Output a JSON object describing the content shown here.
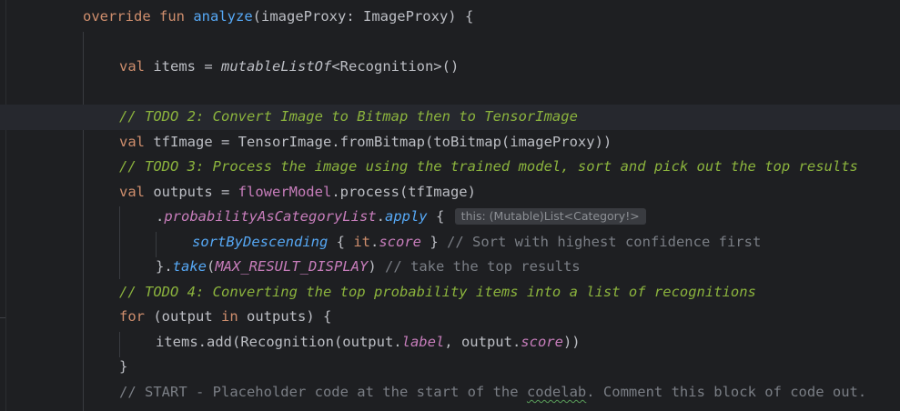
{
  "colors": {
    "background": "#1e1f22",
    "keyword": "#cf8e6d",
    "function": "#56a8f5",
    "comment": "#7a7e85",
    "todo_comment": "#8bb33d",
    "property": "#c77dbb",
    "text": "#bcbec4"
  },
  "code": {
    "l1": {
      "override": "override",
      "fun": "fun",
      "name": "analyze",
      "sig": "(imageProxy: ImageProxy) {"
    },
    "l2": {
      "val": "val",
      "pre": " items = ",
      "call": "mutableListOf",
      "post": "<Recognition>()"
    },
    "l3": {
      "text": "// TODO 2: Convert Image to Bitmap then to TensorImage"
    },
    "l4": {
      "val": "val",
      "text": " tfImage = TensorImage.fromBitmap(toBitmap(imageProxy))"
    },
    "l5": {
      "text": "// TODO 3: Process the image using the trained model, sort and pick out the top results"
    },
    "l6": {
      "val": "val",
      "pre": " outputs = ",
      "prop": "flowerModel",
      "post": ".process(tfImage)"
    },
    "l7": {
      "dot": ".",
      "prop": "probabilityAsCategoryList",
      "dot2": ".",
      "apply": "apply",
      "brace": " {",
      "hint": "this: (Mutable)List<Category!>"
    },
    "l8": {
      "sort": "sortByDescending",
      "open": " { ",
      "it": "it",
      "dot": ".",
      "score": "score",
      "close": " } ",
      "comment": "// Sort with highest confidence first"
    },
    "l9": {
      "close": "}.",
      "take": "take",
      "open": "(",
      "const": "MAX_RESULT_DISPLAY",
      "end": ") ",
      "comment": "// take the top results"
    },
    "l10": {
      "text": "// TODO 4: Converting the top probability items into a list of recognitions"
    },
    "l11": {
      "for": "for",
      "a": " (output ",
      "in": "in",
      "b": " outputs) {"
    },
    "l12": {
      "a": "items.add(Recognition(output.",
      "label": "label",
      "b": ", output.",
      "score": "score",
      "c": "))"
    },
    "l13": {
      "text": "}"
    },
    "l14": {
      "a": "// START - Placeholder code at the start of the ",
      "spell": "codelab",
      "b": ". Comment this block of code out."
    }
  }
}
